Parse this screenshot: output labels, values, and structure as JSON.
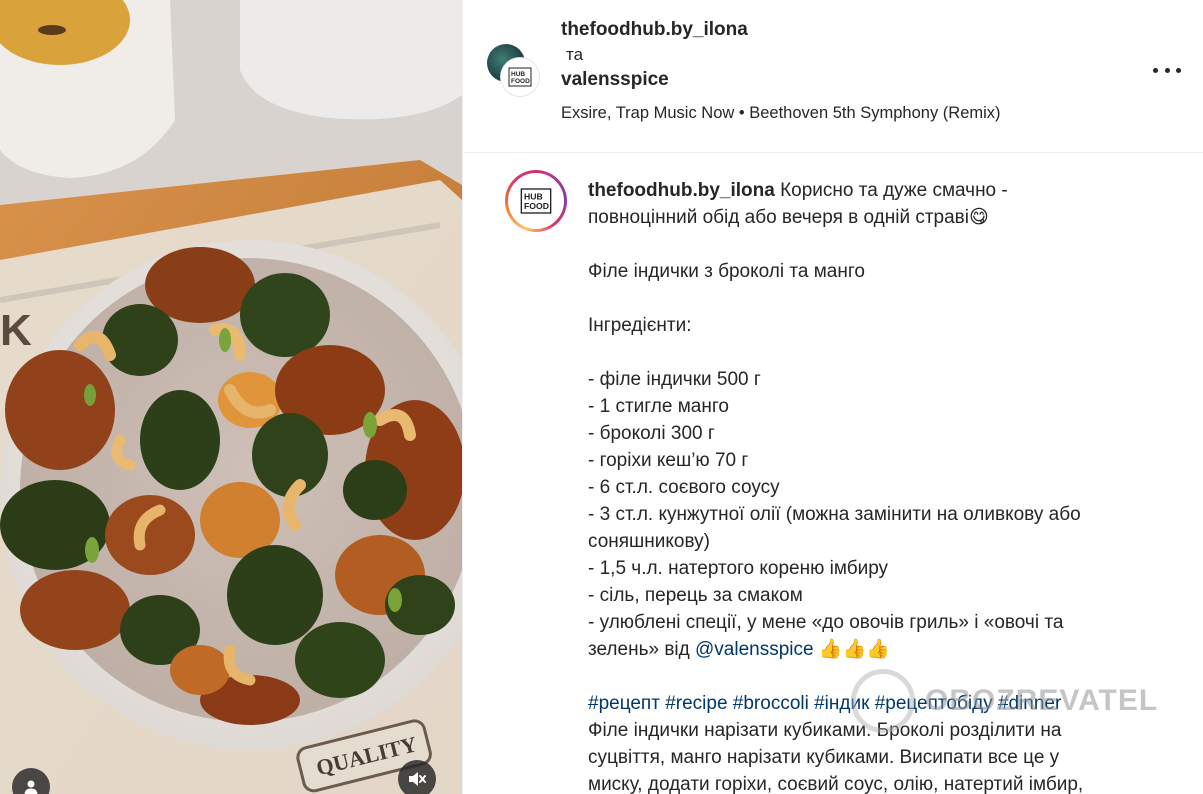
{
  "post": {
    "media": {
      "tag_icon": "user-tag-icon",
      "mute_icon": "speaker-muted-icon",
      "tray_text": "QUALITY"
    },
    "header": {
      "author": "thefoodhub.by_ilona",
      "connector": "та",
      "collaborator": "valensspice",
      "audio": "Exsire, Trap Music Now • Beethoven 5th Symphony (Remix)",
      "more_icon": "more-options-icon"
    },
    "caption": {
      "username": "thefoodhub.by_ilona",
      "intro_1": "Корисно та дуже смачно -",
      "intro_2": "повноцінний обід або вечеря в одній страві",
      "intro_emoji": "😋",
      "title": "Філе індички з броколі та манго",
      "ingredients_heading": "Інгредієнти:",
      "ingredients": [
        "- філе індички 500 г",
        "- 1 стигле манго",
        "- броколі 300 г",
        "- горіхи кеш’ю 70 г",
        "- 6 ст.л. соєвого соусу",
        "- 3 ст.л. кунжутної олії (можна замінити на оливкову або",
        "соняшникову)",
        "- 1,5 ч.л. натертого кореню імбиру",
        "- сіль, перець за смаком",
        "- улюблені спеції, у мене «до овочів гриль» і «овочі та"
      ],
      "spices_line_start": "зелень» від ",
      "spices_mention": "@valensspice",
      "spices_emoji": "👍👍👍",
      "hashtags": "#рецепт #recipe #broccoli #індик #рецептобіду #dinner",
      "method": [
        "Філе індички нарізати кубиками. Броколі розділити на",
        "суцвіття, манго нарізати кубиками. Висипати все це у",
        "миску, додати горіхи, соєвий соус, олію, натертий імбир,"
      ]
    },
    "logo_text": {
      "line1": "HUB",
      "line2": "FOOD"
    },
    "watermark": "OBOZREVATEL",
    "colors": {
      "link": "#00376b",
      "text": "#262626",
      "story_ring": [
        "#fdc468",
        "#e1306c",
        "#833ab4"
      ]
    }
  }
}
